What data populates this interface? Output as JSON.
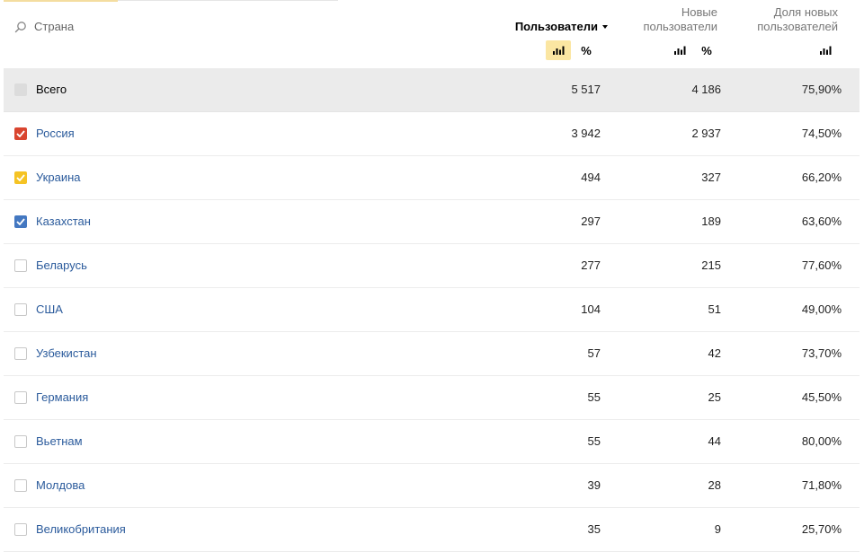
{
  "header": {
    "dimension_label": "Страна",
    "col_users": "Пользователи",
    "col_new_line1": "Новые",
    "col_new_line2": "пользователи",
    "col_share_line1": "Доля новых",
    "col_share_line2": "пользователей",
    "percent_label": "%",
    "icons": {
      "search": "search-icon",
      "sort": "sort-desc-icon",
      "bars": "bar-chart-icon"
    }
  },
  "colors": {
    "accent_yellow": "#fbe6a2",
    "link_blue": "#2b5b9c",
    "check_red": "#d9452f",
    "check_yellow": "#f5c324",
    "check_blue": "#4478c1"
  },
  "total": {
    "label": "Всего",
    "users": "5 517",
    "new_users": "4 186",
    "share": "75,90%"
  },
  "rows": [
    {
      "name": "Россия",
      "users": "3 942",
      "new_users": "2 937",
      "share": "74,50%",
      "checked": true,
      "check_color": "#d9452f"
    },
    {
      "name": "Украина",
      "users": "494",
      "new_users": "327",
      "share": "66,20%",
      "checked": true,
      "check_color": "#f5c324"
    },
    {
      "name": "Казахстан",
      "users": "297",
      "new_users": "189",
      "share": "63,60%",
      "checked": true,
      "check_color": "#4478c1"
    },
    {
      "name": "Беларусь",
      "users": "277",
      "new_users": "215",
      "share": "77,60%",
      "checked": false
    },
    {
      "name": "США",
      "users": "104",
      "new_users": "51",
      "share": "49,00%",
      "checked": false
    },
    {
      "name": "Узбекистан",
      "users": "57",
      "new_users": "42",
      "share": "73,70%",
      "checked": false
    },
    {
      "name": "Германия",
      "users": "55",
      "new_users": "25",
      "share": "45,50%",
      "checked": false
    },
    {
      "name": "Вьетнам",
      "users": "55",
      "new_users": "44",
      "share": "80,00%",
      "checked": false
    },
    {
      "name": "Молдова",
      "users": "39",
      "new_users": "28",
      "share": "71,80%",
      "checked": false
    },
    {
      "name": "Великобритания",
      "users": "35",
      "new_users": "9",
      "share": "25,70%",
      "checked": false
    }
  ]
}
